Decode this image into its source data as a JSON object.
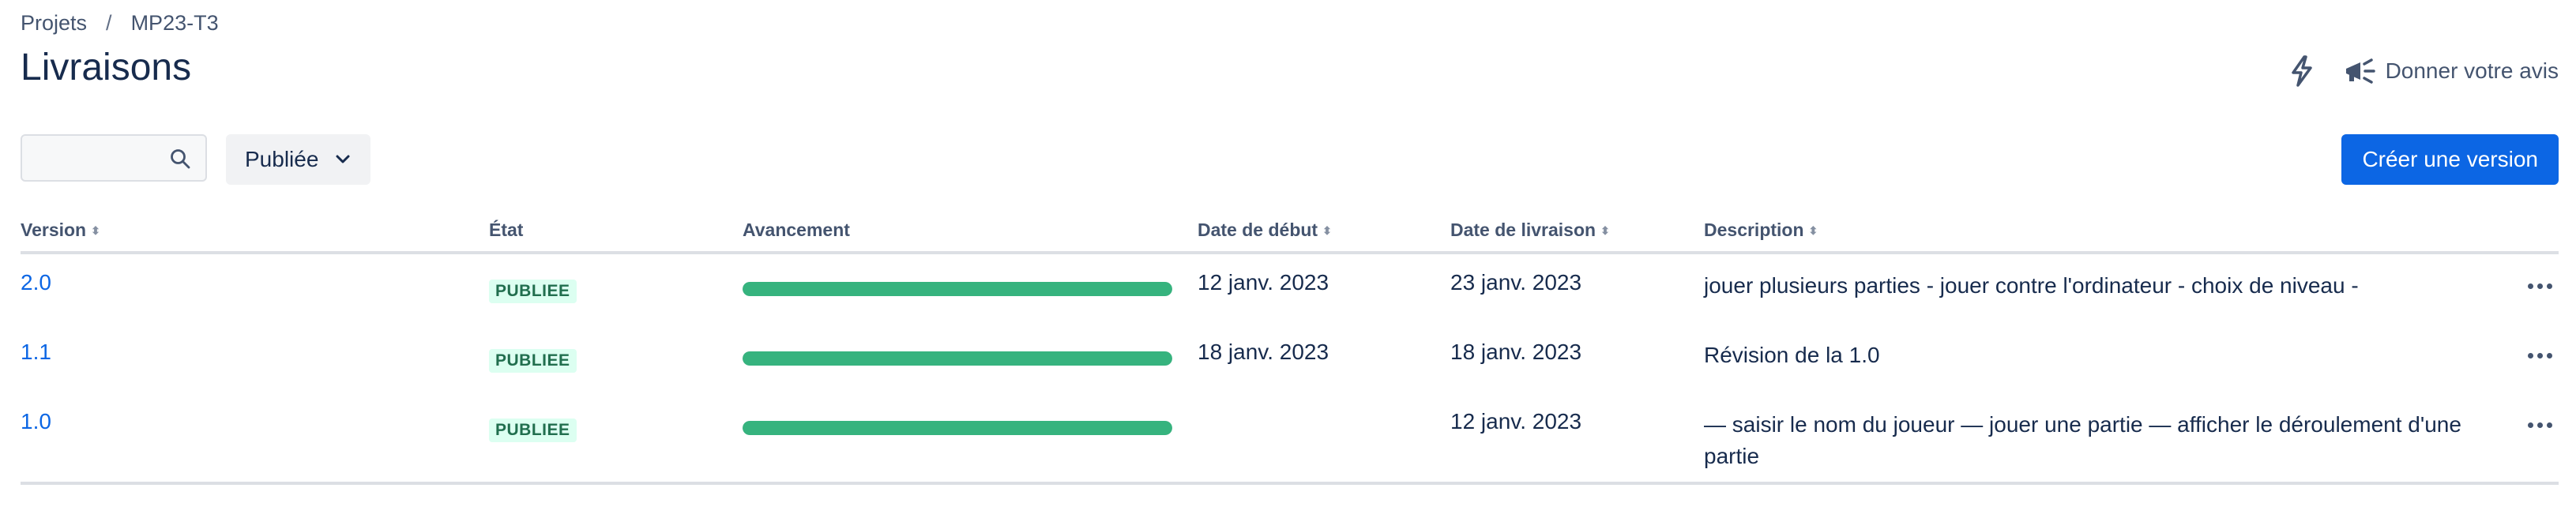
{
  "breadcrumb": {
    "projects": "Projets",
    "separator": "/",
    "project": "MP23-T3"
  },
  "page": {
    "title": "Livraisons"
  },
  "header": {
    "feedback_label": "Donner votre avis",
    "bolt_icon": "bolt-icon",
    "megaphone_icon": "megaphone-icon"
  },
  "toolbar": {
    "search": {
      "value": "",
      "placeholder": ""
    },
    "status_filter": "Publiée",
    "create_label": "Créer une version"
  },
  "table": {
    "columns": {
      "version": "Version",
      "state": "État",
      "progress": "Avancement",
      "start": "Date de début",
      "release": "Date de livraison",
      "description": "Description"
    },
    "rows": [
      {
        "version": "2.0",
        "state": "PUBLIEE",
        "progress": 1.0,
        "start": "12 janv. 2023",
        "release": "23 janv. 2023",
        "description": "jouer plusieurs parties - jouer contre l'ordinateur - choix de niveau -"
      },
      {
        "version": "1.1",
        "state": "PUBLIEE",
        "progress": 1.0,
        "start": "18 janv. 2023",
        "release": "18 janv. 2023",
        "description": "Révision de la 1.0"
      },
      {
        "version": "1.0",
        "state": "PUBLIEE",
        "progress": 1.0,
        "start": "",
        "release": "12 janv. 2023",
        "description": "— saisir le nom du joueur — jouer une partie — afficher le déroulement d'une partie"
      }
    ]
  },
  "colors": {
    "accent": "#0c66e4",
    "progress": "#36b37e",
    "lozenge_bg": "#dcfff1",
    "lozenge_text": "#216e4e"
  }
}
